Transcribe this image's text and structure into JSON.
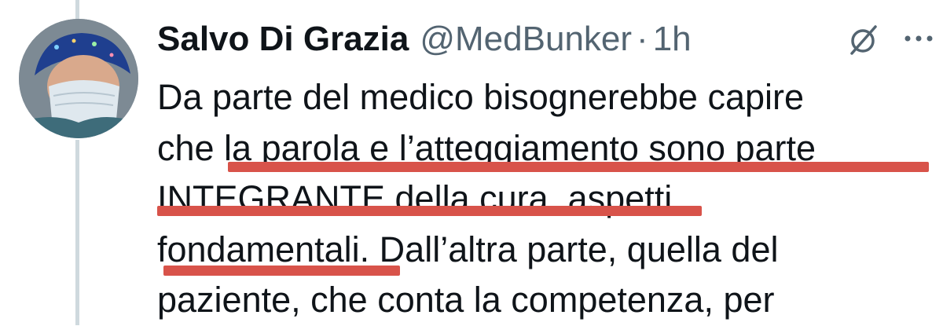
{
  "post": {
    "author_name": "Salvo Di Grazia",
    "handle": "@MedBunker",
    "separator": "·",
    "timestamp": "1h",
    "text_lines": [
      "Da parte del medico bisognerebbe capire",
      "che la parola e l’atteggiamento sono parte",
      "INTEGRANTE della cura, aspetti",
      "fondamentali. Dall’altra parte, quella del",
      "paziente, che conta la competenza, per"
    ]
  },
  "icons": {
    "avatar": "avatar",
    "grok": "grok-icon",
    "more": "more-icon"
  },
  "colors": {
    "highlight_underline": "#d8534a",
    "muted_text": "#536471",
    "thread_line": "#cfd9de"
  }
}
